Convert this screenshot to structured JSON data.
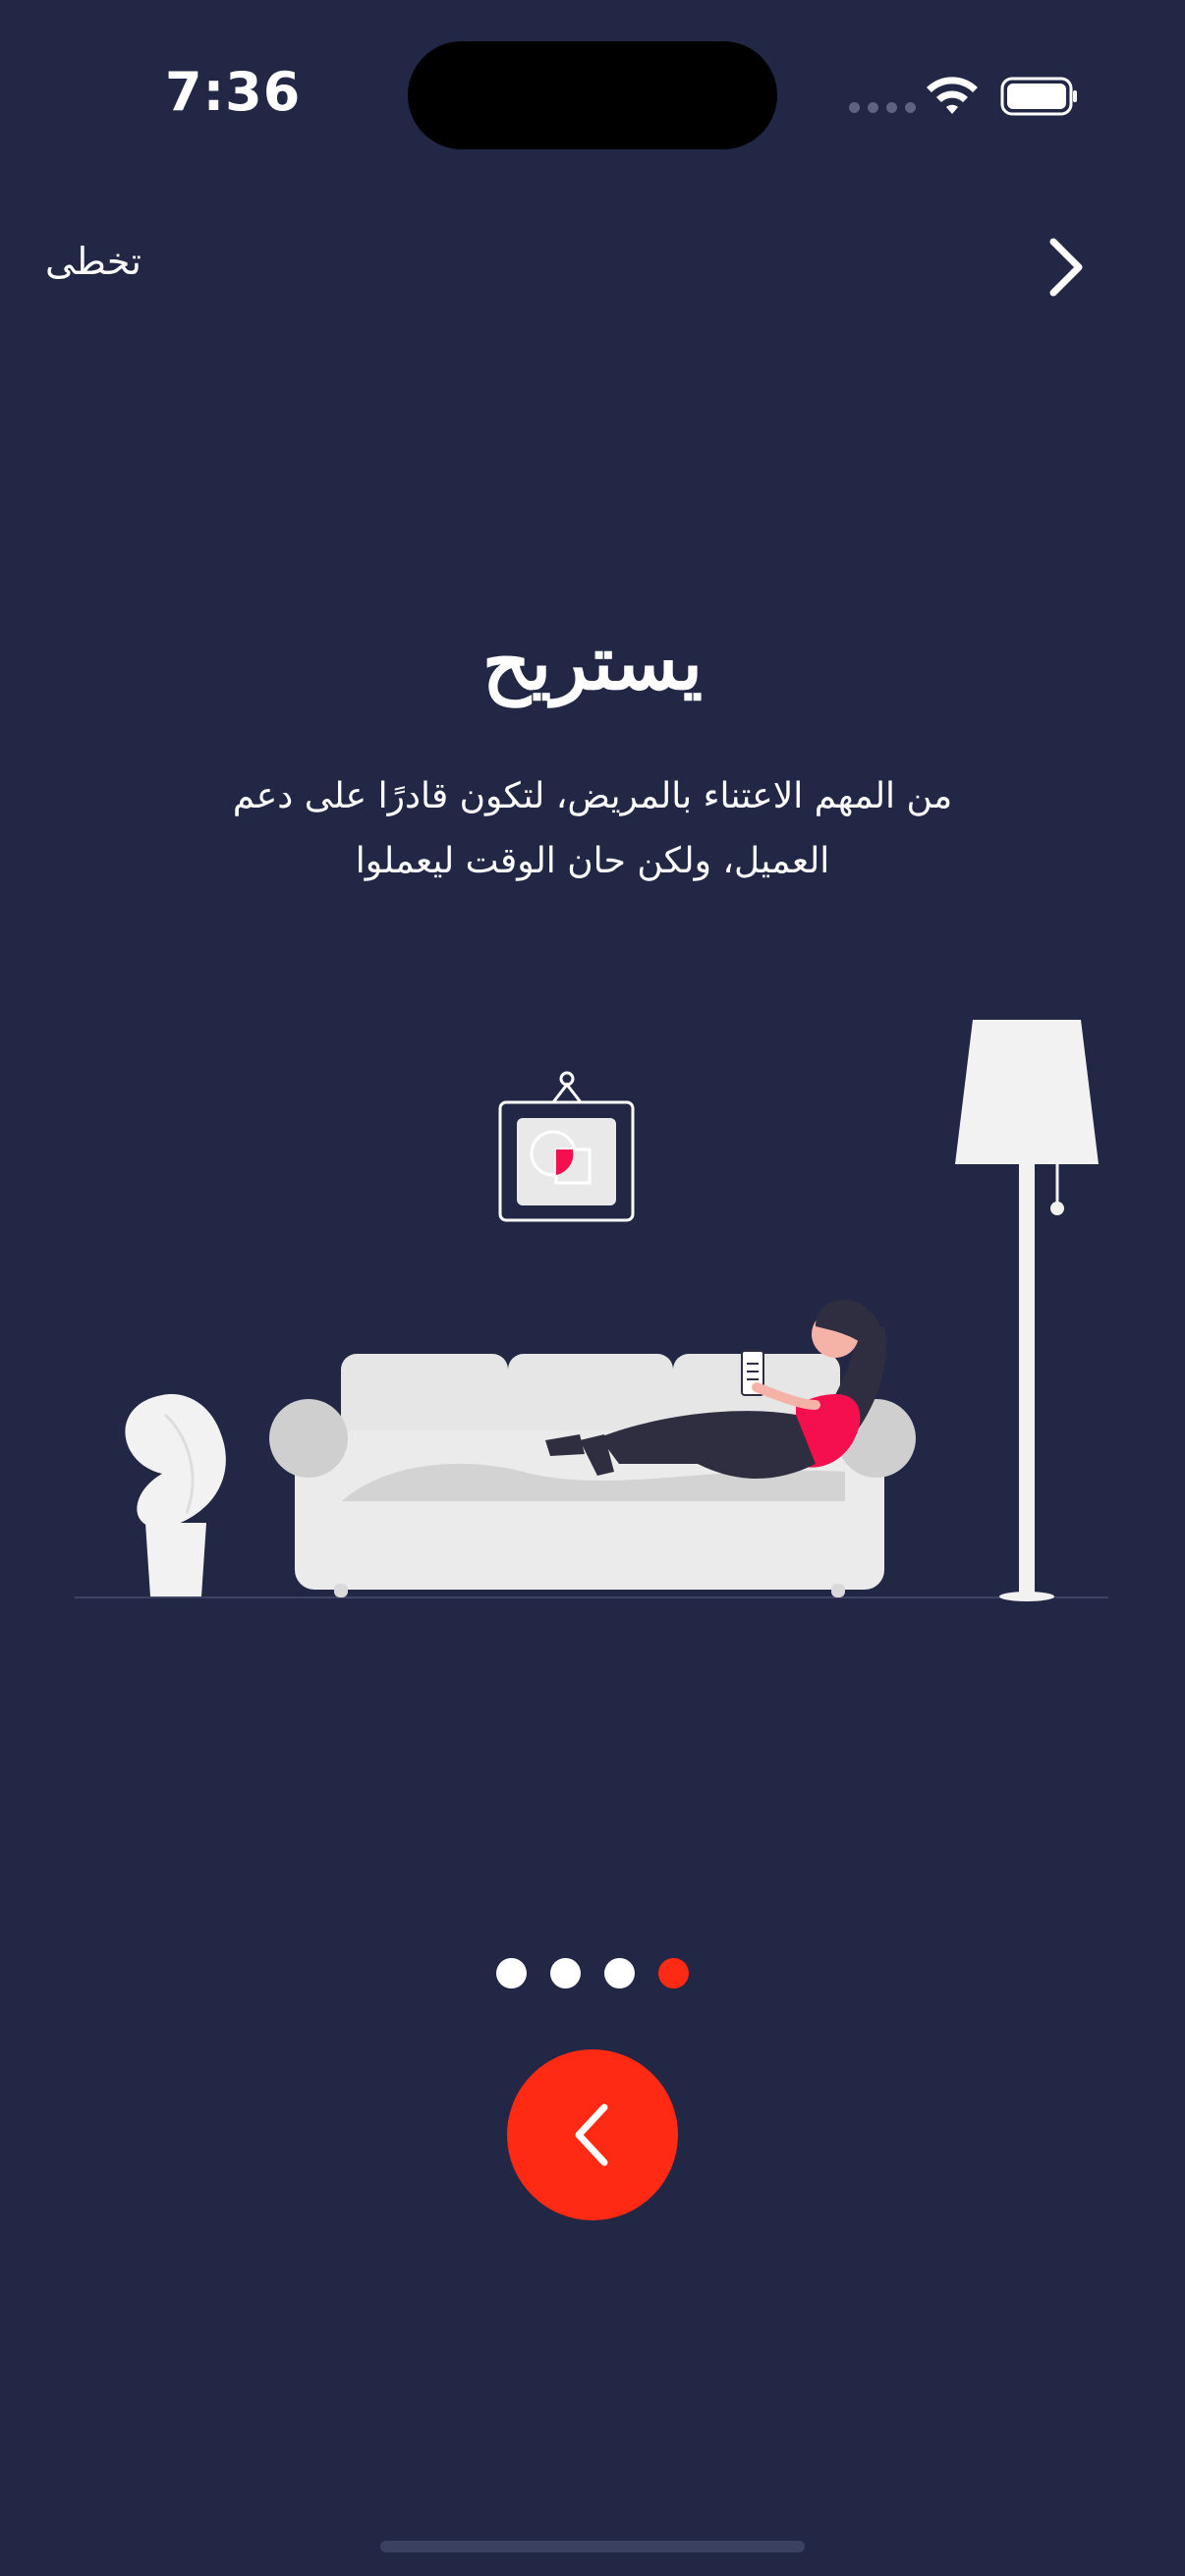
{
  "status_bar": {
    "time": "7:36"
  },
  "nav": {
    "skip_label": "تخطى",
    "next_icon": "chevron-right-icon"
  },
  "content": {
    "title": "يستريح",
    "description_line1": "من المهم الاعتناء بالمريض، لتكون قادرًا على دعم",
    "description_line2": "العميل، ولكن حان الوقت ليعملوا"
  },
  "pagination": {
    "total": 4,
    "active_index": 3
  },
  "back_button": {
    "icon": "chevron-left-icon"
  },
  "colors": {
    "background": "#212744",
    "accent": "#ff2a14",
    "illustration_pink": "#f50f4f"
  }
}
